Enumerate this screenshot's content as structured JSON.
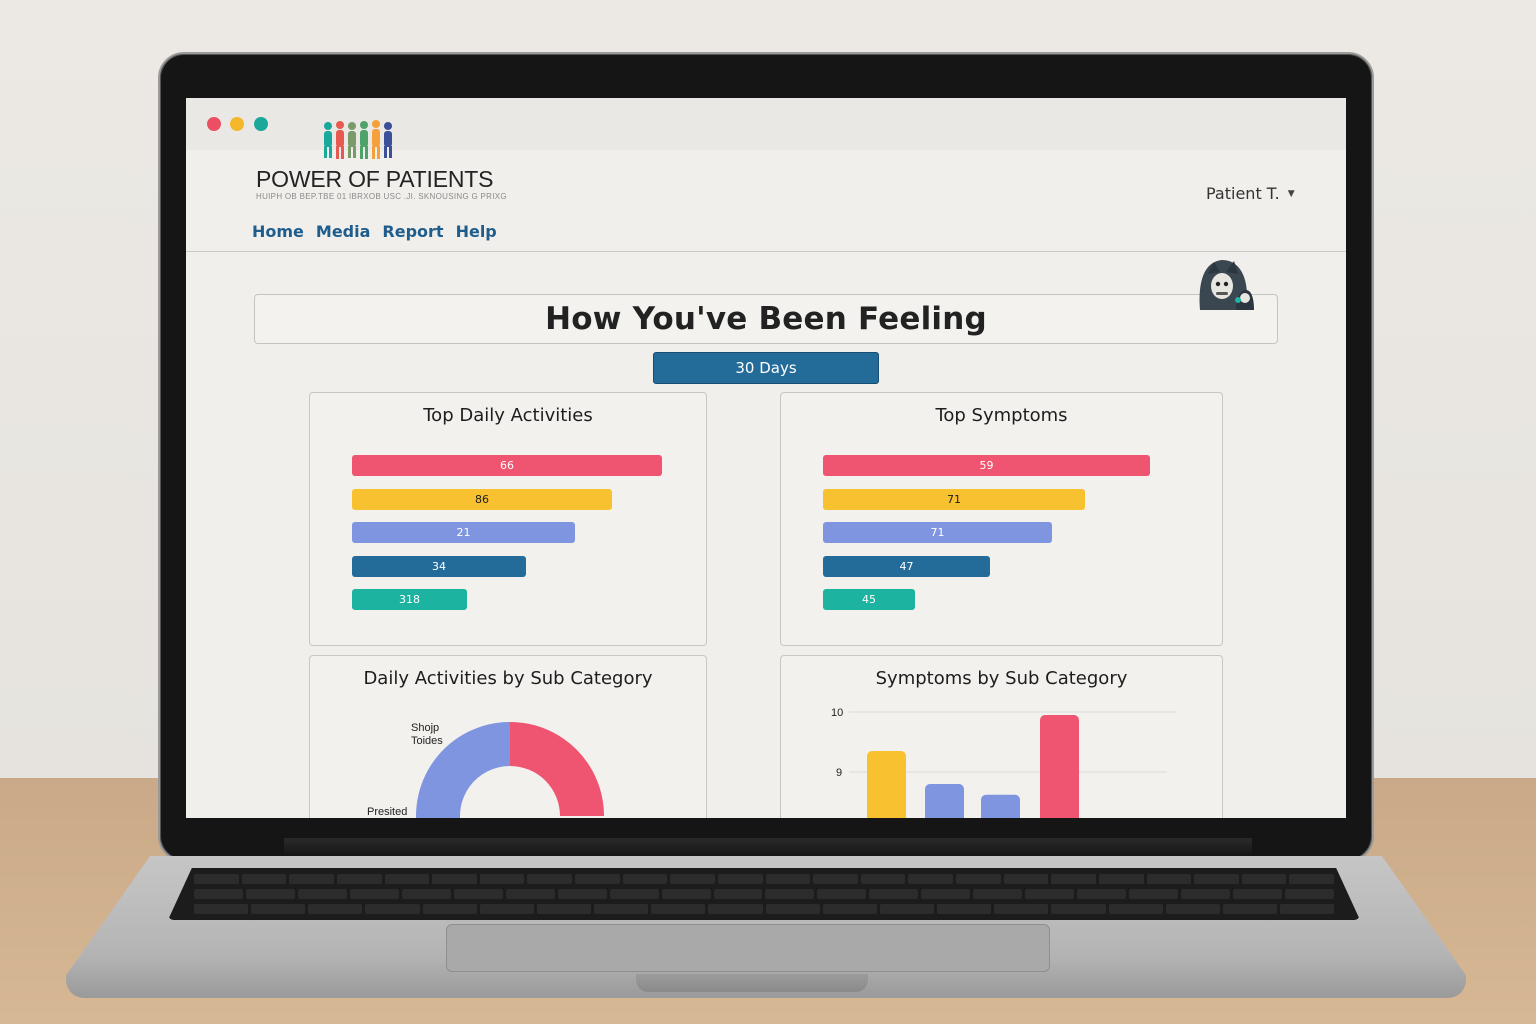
{
  "app": {
    "brand": "POWER OF PATIENTS",
    "tagline": "HUIPH OB BEP.TBE 01 IBRXOB USC  .JI. SKNOUSING G PRIXG",
    "user": "Patient T."
  },
  "nav": {
    "items": [
      "Home",
      "Media",
      "Report",
      "Help"
    ]
  },
  "page": {
    "title": "How You've Been Feeling",
    "range_button": "30 Days"
  },
  "colors": {
    "red": "#ef5470",
    "yellow": "#f8c12f",
    "periwinkle": "#7f95e0",
    "blue": "#236b99",
    "teal": "#1cb3a1",
    "nav_link": "#1f5d8c"
  },
  "cards": {
    "top_daily_activities": {
      "title": "Top Daily Activities",
      "labels": [
        "66",
        "86",
        "21",
        "34",
        "318"
      ]
    },
    "top_symptoms": {
      "title": "Top Symptoms",
      "labels": [
        "59",
        "71",
        "71",
        "47",
        "45"
      ]
    },
    "daily_by_sub": {
      "title": "Daily Activities by Sub Category",
      "slice_labels": [
        "Shojp Toides",
        "Presited"
      ]
    },
    "symptoms_by_sub": {
      "title": "Symptoms by Sub Category",
      "ytick_labels": [
        "10",
        "9"
      ]
    }
  },
  "chart_data": [
    {
      "type": "bar",
      "title": "Top Daily Activities",
      "orientation": "horizontal",
      "values": [
        66,
        86,
        21,
        34,
        318
      ],
      "relative_lengths": [
        1.0,
        0.84,
        0.72,
        0.56,
        0.37
      ],
      "colors": [
        "#ef5470",
        "#f8c12f",
        "#7f95e0",
        "#236b99",
        "#1cb3a1"
      ]
    },
    {
      "type": "bar",
      "title": "Top Symptoms",
      "orientation": "horizontal",
      "values": [
        59,
        71,
        71,
        47,
        45
      ],
      "relative_lengths": [
        1.0,
        0.8,
        0.7,
        0.51,
        0.28
      ],
      "colors": [
        "#ef5470",
        "#f8c12f",
        "#7f95e0",
        "#236b99",
        "#1cb3a1"
      ]
    },
    {
      "type": "pie",
      "title": "Daily Activities by Sub Category",
      "slices": [
        {
          "label": "Shojp Toides",
          "value": 0.28,
          "color": "#7f95e0"
        },
        {
          "label": "Presited",
          "value": 0.07,
          "color": "#f8c12f"
        },
        {
          "label": "",
          "value": 0.25,
          "color": "#ef5470"
        }
      ]
    },
    {
      "type": "bar",
      "title": "Symptoms by Sub Category",
      "yticks": [
        10,
        9
      ],
      "values": [
        9.35,
        8.8,
        8.62,
        9.95
      ],
      "colors": [
        "#f8c12f",
        "#7f95e0",
        "#7f95e0",
        "#ef5470"
      ]
    }
  ]
}
